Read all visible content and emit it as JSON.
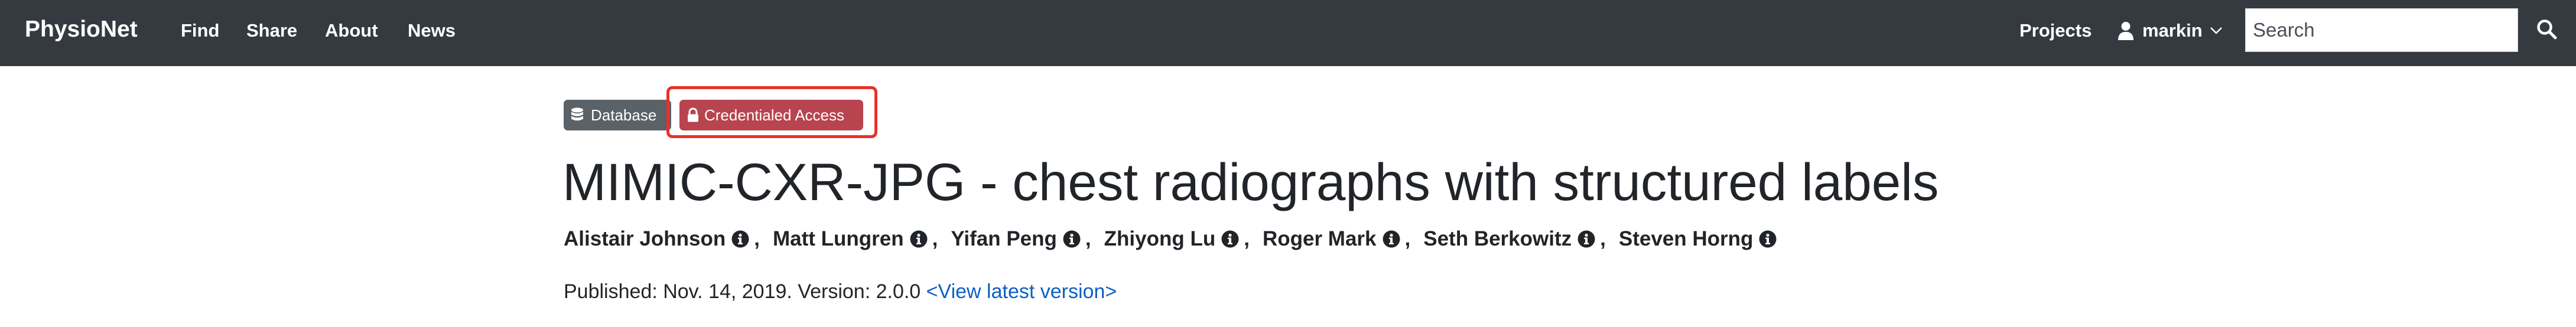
{
  "navbar": {
    "brand": "PhysioNet",
    "links": [
      "Find",
      "Share",
      "About",
      "News"
    ],
    "projects_label": "Projects",
    "user_name": "markin",
    "search_placeholder": "Search",
    "background_color": "#343a40",
    "icons": {
      "user": "user-icon",
      "caret": "chevron-down-icon",
      "search": "search-icon"
    }
  },
  "badges": {
    "database": {
      "label": "Database",
      "icon": "database-icon",
      "color": "#5a6268"
    },
    "credentialed": {
      "label": "Credentialed Access",
      "icon": "lock-icon",
      "color": "#b7444f"
    }
  },
  "highlight_color": "#e8302a",
  "project": {
    "title": "MIMIC-CXR-JPG - chest radiographs with structured labels",
    "authors": [
      "Alistair Johnson",
      "Matt Lungren",
      "Yifan Peng",
      "Zhiyong Lu",
      "Roger Mark",
      "Seth Berkowitz",
      "Steven Horng"
    ],
    "author_separator": ",",
    "author_info_icon": "info-circle-icon",
    "published_text": "Published: Nov. 14, 2019. Version: 2.0.0",
    "latest_version_link": "<View latest version>",
    "link_color": "#0d5fc4"
  }
}
